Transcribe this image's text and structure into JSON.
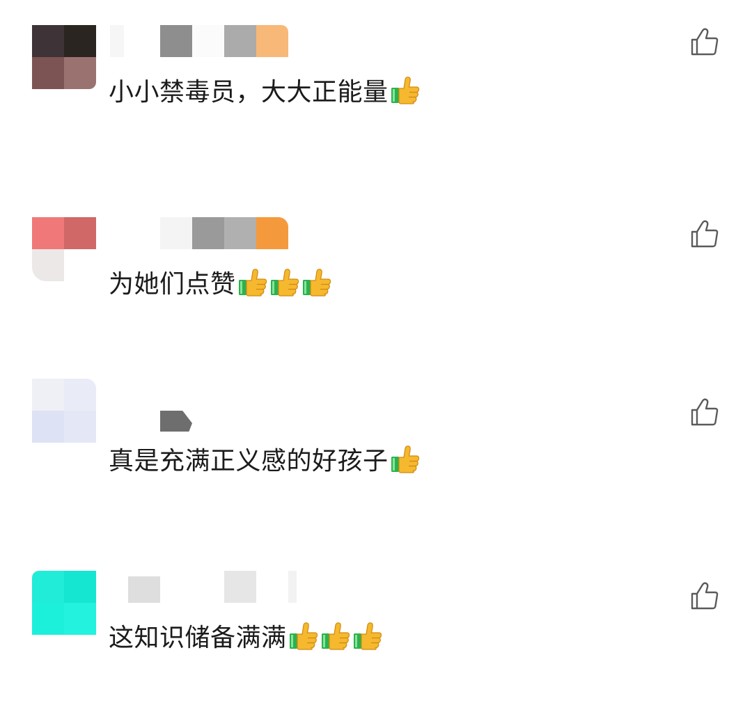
{
  "comments": [
    {
      "text": "小小禁毒员，大大正能量",
      "emoji_count": 1,
      "emoji": "thumbs-up-emoji",
      "like_icon": "thumbs-up-outline-icon"
    },
    {
      "text": "为她们点赞",
      "emoji_count": 3,
      "emoji": "thumbs-up-emoji",
      "like_icon": "thumbs-up-outline-icon"
    },
    {
      "text": "真是充满正义感的好孩子",
      "emoji_count": 1,
      "emoji": "thumbs-up-emoji",
      "like_icon": "thumbs-up-outline-icon"
    },
    {
      "text": "这知识储备满满",
      "emoji_count": 3,
      "emoji": "thumbs-up-emoji",
      "like_icon": "thumbs-up-outline-icon"
    }
  ],
  "colors": {
    "text": "#1b1b1b",
    "icon_stroke": "#5a5a5a",
    "emoji_hand": "#f5b82e",
    "emoji_sleeve": "#2bb24c"
  }
}
